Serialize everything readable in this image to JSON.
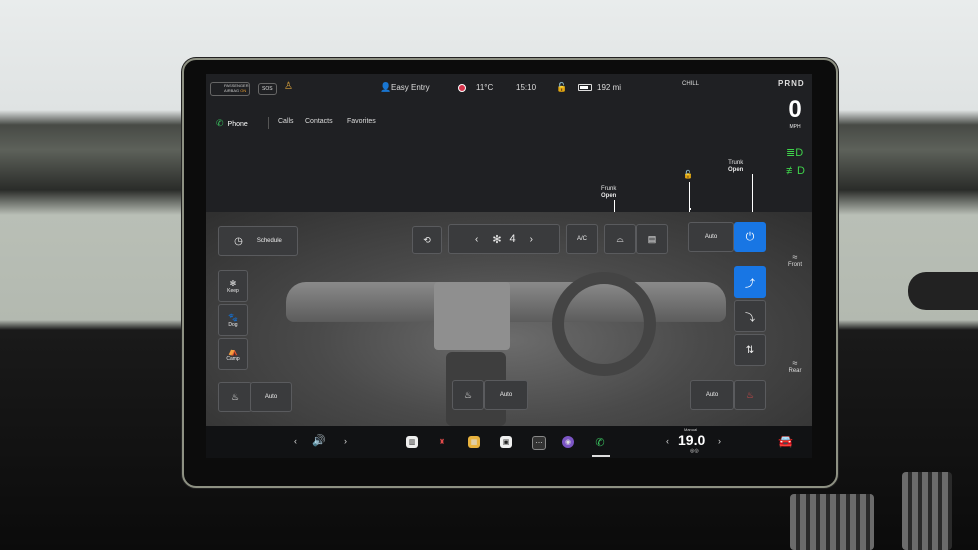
{
  "status_bar": {
    "airbag_line1": "PASSENGER",
    "airbag_line2": "AIRBAG",
    "airbag_state": "ON",
    "sos": "SOS",
    "profile": "Easy Entry",
    "temperature": "11°C",
    "time": "15:10",
    "range": "192 mi",
    "drive_mode": "CHILL",
    "gears": "PRND"
  },
  "gauge": {
    "speed": "0",
    "unit": "MPH"
  },
  "vehicle": {
    "frunk_label": "Frunk",
    "frunk_state": "Open",
    "trunk_label": "Trunk",
    "trunk_state": "Open"
  },
  "phone": {
    "title": "Phone",
    "tabs": [
      "Calls",
      "Contacts",
      "Favorites"
    ]
  },
  "climate": {
    "schedule": "Schedule",
    "fan_speed": "4",
    "ac": "A/C",
    "auto_main": "Auto",
    "front_label": "Front",
    "rear_label": "Rear",
    "keep": "Keep",
    "dog": "Dog",
    "camp": "Camp",
    "left_seat_auto": "Auto",
    "center_auto": "Auto",
    "right_seat_auto": "Auto"
  },
  "dock": {
    "cabin_temp_mode": "Manual",
    "cabin_temp": "19.0"
  },
  "colors": {
    "accent": "#1876e4",
    "phone_green": "#3ac25f",
    "lights_green": "#3fd24b",
    "record_red": "#d7334b"
  }
}
